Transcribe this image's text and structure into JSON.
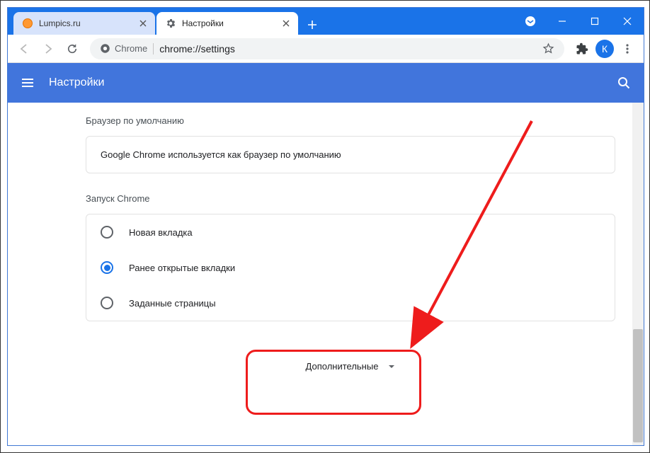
{
  "window": {
    "tabs": [
      {
        "title": "Lumpics.ru",
        "active": false,
        "favicon": "orange-circle"
      },
      {
        "title": "Настройки",
        "active": true,
        "favicon": "gear"
      }
    ],
    "profile_letter": "К"
  },
  "omnibox": {
    "security_label": "Chrome",
    "url": "chrome://settings"
  },
  "settings": {
    "page_title": "Настройки",
    "sections": {
      "default_browser": {
        "label": "Браузер по умолчанию",
        "status": "Google Chrome используется как браузер по умолчанию"
      },
      "on_startup": {
        "label": "Запуск Chrome",
        "options": [
          {
            "label": "Новая вкладка",
            "selected": false
          },
          {
            "label": "Ранее открытые вкладки",
            "selected": true
          },
          {
            "label": "Заданные страницы",
            "selected": false
          }
        ]
      }
    },
    "advanced_label": "Дополнительные"
  },
  "colors": {
    "accent": "#1a73e8",
    "annotation": "#ee1c1c"
  }
}
